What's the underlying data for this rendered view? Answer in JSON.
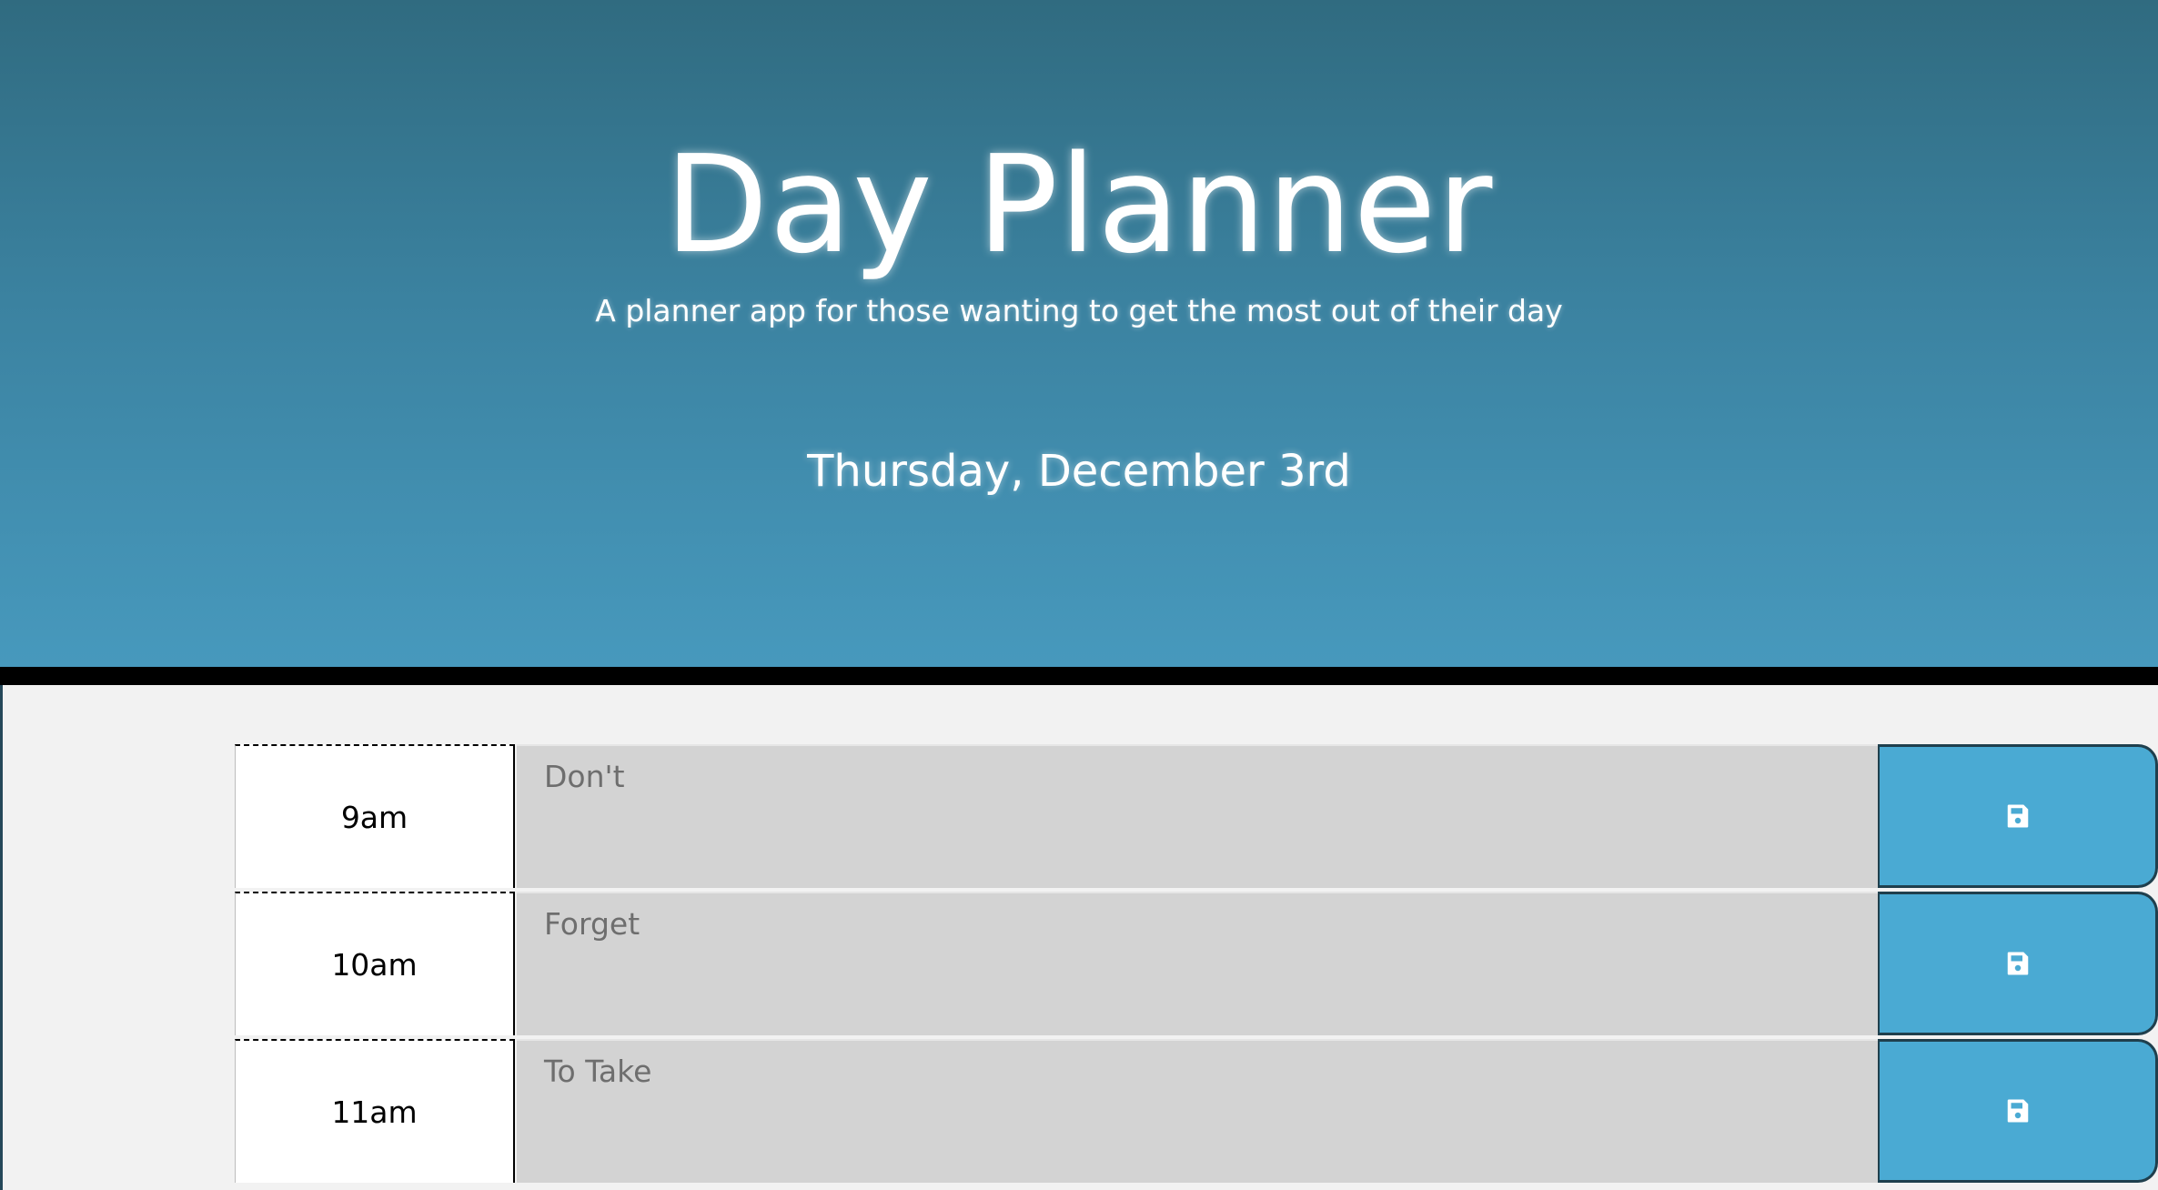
{
  "header": {
    "title": "Day Planner",
    "subtitle": "A planner app for those wanting to get the most out of their day",
    "current_day": "Thursday, December 3rd"
  },
  "planner": {
    "rows": [
      {
        "hour": "9am",
        "text": "Don't",
        "save_icon": "save-icon"
      },
      {
        "hour": "10am",
        "text": "Forget",
        "save_icon": "save-icon"
      },
      {
        "hour": "11am",
        "text": "To Take",
        "save_icon": "save-icon"
      }
    ]
  },
  "colors": {
    "header_top": "#306b80",
    "header_bottom": "#4799bd",
    "save_button": "#4aaad3",
    "entry_background": "#d3d3d3",
    "page_background": "#f2f2f2"
  }
}
